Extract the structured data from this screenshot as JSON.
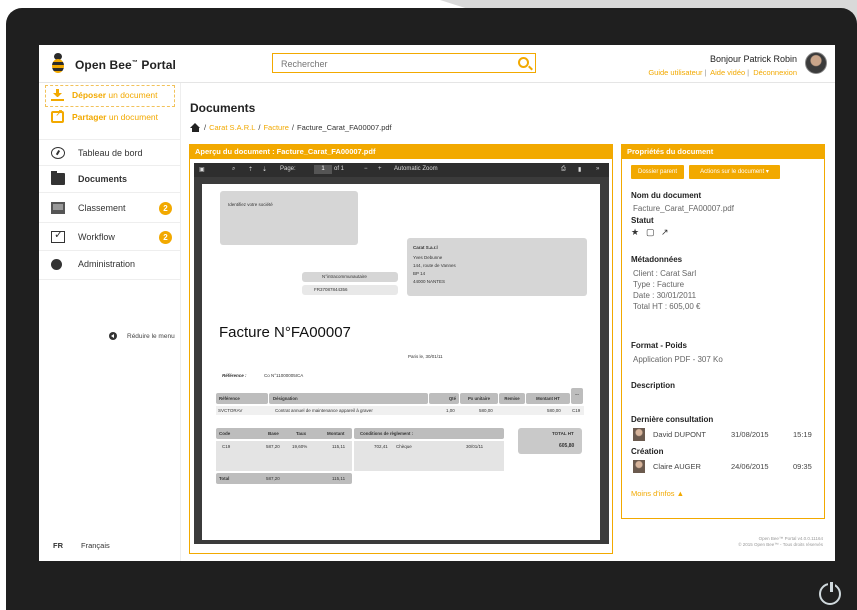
{
  "header": {
    "brand": "Open Bee",
    "brand_tm": "™",
    "brand_suffix": "Portal",
    "search_placeholder": "Rechercher",
    "greeting": "Bonjour Patrick Robin",
    "links": [
      "Guide utilisateur",
      "Aide vidéo",
      "Déconnexion"
    ]
  },
  "sidebar": {
    "actions": [
      {
        "bold": "Déposer",
        "rest": " un document"
      },
      {
        "bold": "Partager",
        "rest": " un document"
      }
    ],
    "items": [
      {
        "label": "Tableau de bord",
        "icon": "dashboard-icon"
      },
      {
        "label": "Documents",
        "icon": "folder-icon",
        "active": true
      },
      {
        "label": "Classement",
        "icon": "archive-icon",
        "badge": "2"
      },
      {
        "label": "Workflow",
        "icon": "workflow-icon",
        "badge": "2"
      },
      {
        "label": "Administration",
        "icon": "gear-icon"
      }
    ],
    "reduce": "Réduire le menu",
    "lang_code": "FR",
    "lang_name": "Français"
  },
  "main": {
    "title": "Documents",
    "breadcrumb": {
      "sep": "/",
      "c1": "Carat S.A.R.L",
      "c2": "Facture",
      "current": "Facture_Carat_FA00007.pdf"
    },
    "preview_header": "Aperçu du document : Facture_Carat_FA00007.pdf"
  },
  "viewer": {
    "page_label": "Page:",
    "page_value": "1",
    "page_of": "of 1",
    "zoom": "Automatic Zoom"
  },
  "invoice": {
    "logo_placeholder": "Identifiez votre société",
    "recipient": [
      "Carat S.a.r.l",
      "Yves Debunne",
      "144, route de Vannes",
      "BP 14",
      "44000 NANTES"
    ],
    "vat_label": "N°intracommunautaire",
    "vat_value": "FR37087844356",
    "title": "Facture N°FA00007",
    "place_date": "Paris le, 30/01/11",
    "ref_label": "Référence :",
    "ref_value": "Co N°11000005ICA",
    "columns": [
      "Référence",
      "Désignation",
      "Qté",
      "Px unitaire",
      "Remise",
      "Montant HT",
      "..."
    ],
    "row": [
      "SVCTORAV",
      "Contrat annuel de maintenance appareil à graver",
      "1,00",
      "580,00",
      "",
      "580,00",
      "C19"
    ],
    "tax_columns": [
      "Code",
      "Base",
      "Taux",
      "Montant"
    ],
    "tax_row": [
      "C19",
      "587,20",
      "19,60%",
      "115,11"
    ],
    "tax_total": [
      "Total",
      "587,20",
      "",
      "115,11"
    ],
    "payment_label": "Conditions de règlement :",
    "payment_row": [
      "702,41",
      "Chèque",
      "30/01/11"
    ],
    "total_label": "TOTAL HT",
    "total_value": "605,80"
  },
  "properties": {
    "header": "Propriétés du document",
    "btn_parent": "Dossier parent",
    "btn_actions": "Actions sur le document",
    "name_label": "Nom du document",
    "name_value": "Facture_Carat_FA00007.pdf",
    "status_label": "Statut",
    "meta_label": "Métadonnées",
    "meta_values": [
      "Client : Carat Sarl",
      "Type : Facture",
      "Date : 30/01/2011",
      "Total HT : 605,00 €"
    ],
    "format_label": "Format - Poids",
    "format_value": "Application PDF - 307 Ko",
    "desc_label": "Description",
    "last_label": "Dernière consultation",
    "last": {
      "name": "David DUPONT",
      "date": "31/08/2015",
      "time": "15:19"
    },
    "creation_label": "Création",
    "creation": {
      "name": "Claire AUGER",
      "date": "24/06/2015",
      "time": "09:35"
    },
    "less": "Moins d'infos ▲",
    "footer1": "Open Bee™ Portal v4.0.0.11164",
    "footer2": "© 2015 Open Bee™ - Tous droits réservés"
  },
  "colors": {
    "accent": "#f2a900",
    "frame": "#1f1f1f",
    "viewer": "#3b3b3b"
  }
}
